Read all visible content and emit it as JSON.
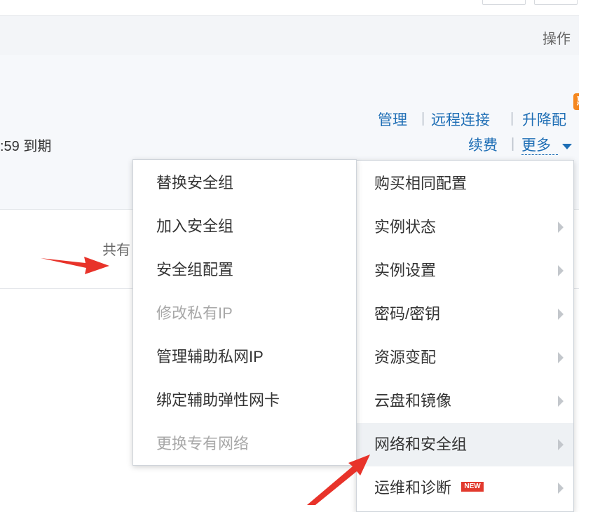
{
  "table": {
    "op_header": "操作",
    "expire_text": ":59 到期",
    "total_text": "共有"
  },
  "actions": {
    "manage": "管理",
    "remote_connect": "远程连接",
    "upgrade": "升降配",
    "renew": "续费",
    "more": "更多",
    "badge": "惠"
  },
  "main_menu": {
    "items": [
      {
        "label": "购买相同配置"
      },
      {
        "label": "实例状态"
      },
      {
        "label": "实例设置"
      },
      {
        "label": "密码/密钥"
      },
      {
        "label": "资源变配"
      },
      {
        "label": "云盘和镜像"
      },
      {
        "label": "网络和安全组"
      },
      {
        "label": "运维和诊断",
        "badge": "NEW"
      }
    ]
  },
  "sub_menu": {
    "items": [
      {
        "label": "替换安全组"
      },
      {
        "label": "加入安全组"
      },
      {
        "label": "安全组配置"
      },
      {
        "label": "修改私有IP"
      },
      {
        "label": "管理辅助私网IP"
      },
      {
        "label": "绑定辅助弹性网卡"
      },
      {
        "label": "更换专有网络"
      }
    ]
  },
  "colors": {
    "link": "#1e6eb5",
    "arrow": "#e8332a",
    "header_bg": "#f3f5f8"
  }
}
